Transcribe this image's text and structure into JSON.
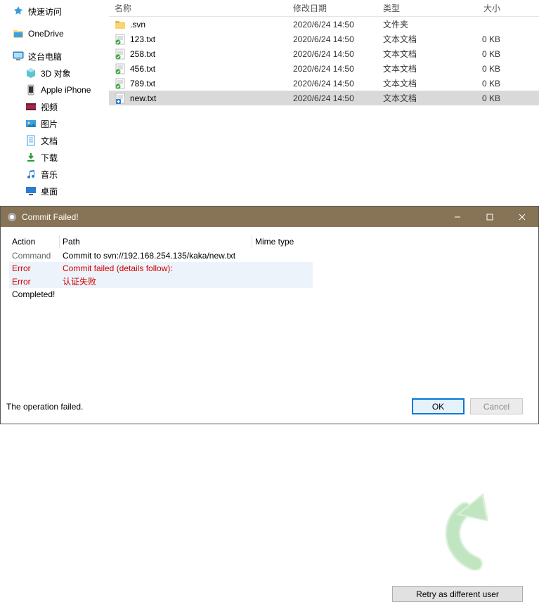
{
  "explorer": {
    "headers": {
      "name": "名称",
      "date": "修改日期",
      "type": "类型",
      "size": "大小"
    },
    "sidebar": [
      {
        "label": "快速访问",
        "icon": "star-blue",
        "level": 1
      },
      {
        "label": "OneDrive",
        "icon": "folder-blue",
        "level": 1
      },
      {
        "label": "这台电脑",
        "icon": "monitor",
        "level": 1
      },
      {
        "label": "3D 对象",
        "icon": "cube",
        "level": 2
      },
      {
        "label": "Apple iPhone",
        "icon": "iphone",
        "level": 2
      },
      {
        "label": "视频",
        "icon": "video",
        "level": 2
      },
      {
        "label": "图片",
        "icon": "picture",
        "level": 2
      },
      {
        "label": "文档",
        "icon": "doc",
        "level": 2
      },
      {
        "label": "下载",
        "icon": "download",
        "level": 2
      },
      {
        "label": "音乐",
        "icon": "music",
        "level": 2
      },
      {
        "label": "桌面",
        "icon": "desktop",
        "level": 2
      }
    ],
    "files": [
      {
        "name": ".svn",
        "date": "2020/6/24 14:50",
        "type": "文件夹",
        "size": "",
        "icon": "folder",
        "selected": false
      },
      {
        "name": "123.txt",
        "date": "2020/6/24 14:50",
        "type": "文本文档",
        "size": "0 KB",
        "icon": "txt-svn",
        "selected": false
      },
      {
        "name": "258.txt",
        "date": "2020/6/24 14:50",
        "type": "文本文档",
        "size": "0 KB",
        "icon": "txt-svn",
        "selected": false
      },
      {
        "name": "456.txt",
        "date": "2020/6/24 14:50",
        "type": "文本文档",
        "size": "0 KB",
        "icon": "txt-svn",
        "selected": false
      },
      {
        "name": "789.txt",
        "date": "2020/6/24 14:50",
        "type": "文本文档",
        "size": "0 KB",
        "icon": "txt-svn",
        "selected": false
      },
      {
        "name": "new.txt",
        "date": "2020/6/24 14:50",
        "type": "文本文档",
        "size": "0 KB",
        "icon": "txt-add",
        "selected": true
      }
    ]
  },
  "dialog": {
    "title": "Commit Failed!",
    "headers": {
      "action": "Action",
      "path": "Path",
      "mime": "Mime type"
    },
    "rows": [
      {
        "action": "Command",
        "path": "Commit to svn://192.168.254.135/kaka/new.txt",
        "mime": "",
        "acolor": "c-gray",
        "pcolor": "c-black",
        "alt": false
      },
      {
        "action": "Error",
        "path": "Commit failed (details follow):",
        "mime": "",
        "acolor": "c-red",
        "pcolor": "c-red",
        "alt": true
      },
      {
        "action": "Error",
        "path": "认证失败",
        "mime": "",
        "acolor": "c-red",
        "pcolor": "c-red",
        "alt": true
      },
      {
        "action": "Completed!",
        "path": "",
        "mime": "",
        "acolor": "c-black",
        "pcolor": "c-black",
        "alt": false
      }
    ],
    "retry_label": "Retry as different user",
    "status": "The operation failed.",
    "ok_label": "OK",
    "cancel_label": "Cancel"
  }
}
